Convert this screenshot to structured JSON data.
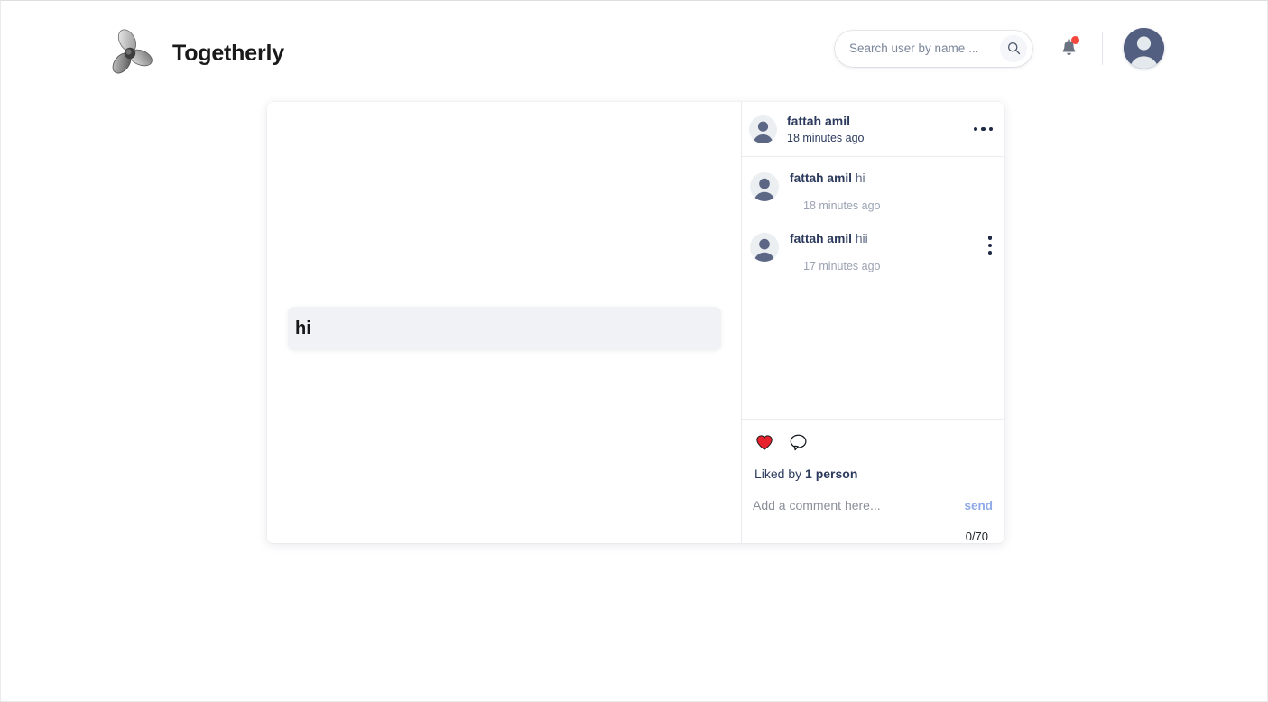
{
  "navbar": {
    "logo_icon": "propeller-logo-icon",
    "brand_title": "Togetherly",
    "search": {
      "placeholder": "Search user by name ...",
      "value": "",
      "icon": "search-icon"
    },
    "notifications": {
      "icon": "bell-icon",
      "has_unread_dot": true,
      "dot_color": "#f4483f"
    },
    "profile": {
      "icon": "avatar",
      "avatar_bg": "#525f81"
    }
  },
  "post": {
    "content_text": "hi",
    "header": {
      "author": "fattah amil",
      "time": "18 minutes ago",
      "menu_icon": "ellipsis-horizontal-icon"
    },
    "comments": [
      {
        "author": "fattah amil",
        "text": "hi",
        "time": "18 minutes ago",
        "has_menu": false
      },
      {
        "author": "fattah amil",
        "text": "hii",
        "time": "17 minutes ago",
        "has_menu": true,
        "menu_icon": "ellipsis-vertical-icon"
      }
    ],
    "actions": {
      "like_icon": "heart-filled-icon",
      "like_color": "#e8212f",
      "comment_icon": "comment-bubble-icon",
      "likes_prefix": "Liked by",
      "likes_count": "1 person"
    },
    "comment_form": {
      "placeholder": "Add a comment here...",
      "value": "",
      "send_label": "send",
      "send_color": "#8fa9e8",
      "char_count": "0/70"
    }
  }
}
